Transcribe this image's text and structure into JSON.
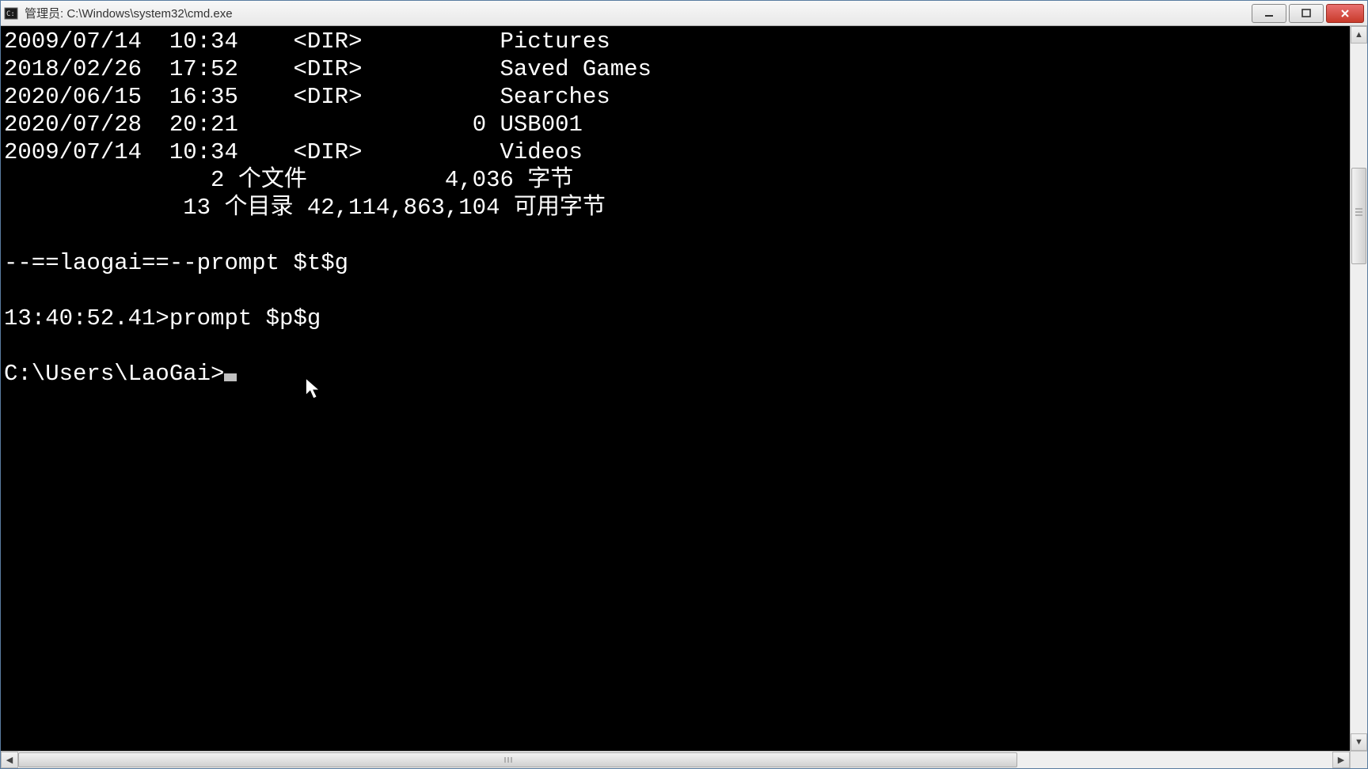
{
  "window": {
    "title": "管理员: C:\\Windows\\system32\\cmd.exe"
  },
  "dir_listing": {
    "entries": [
      {
        "date": "2009/07/14",
        "time": "10:34",
        "type": "<DIR>",
        "size": "",
        "name": "Pictures"
      },
      {
        "date": "2018/02/26",
        "time": "17:52",
        "type": "<DIR>",
        "size": "",
        "name": "Saved Games"
      },
      {
        "date": "2020/06/15",
        "time": "16:35",
        "type": "<DIR>",
        "size": "",
        "name": "Searches"
      },
      {
        "date": "2020/07/28",
        "time": "20:21",
        "type": "",
        "size": "0",
        "name": "USB001"
      },
      {
        "date": "2009/07/14",
        "time": "10:34",
        "type": "<DIR>",
        "size": "",
        "name": "Videos"
      }
    ],
    "summary_files_count": "2",
    "summary_files_label": "个文件",
    "summary_files_bytes": "4,036",
    "summary_bytes_label": "字节",
    "summary_dirs_count": "13",
    "summary_dirs_label": "个目录",
    "summary_free_bytes": "42,114,863,104",
    "summary_free_label": "可用字节"
  },
  "lines": {
    "l1": "--==laogai==--prompt $t$g",
    "l2": "13:40:52.41>prompt $p$g",
    "l3": "C:\\Users\\LaoGai>"
  }
}
